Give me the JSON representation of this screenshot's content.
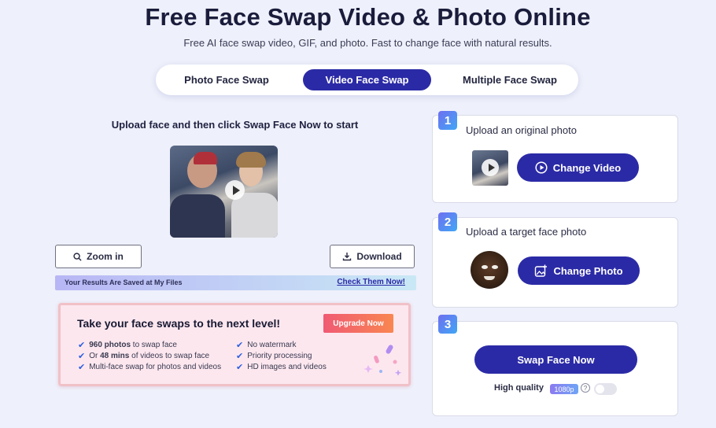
{
  "header": {
    "title": "Free Face Swap Video & Photo Online",
    "subtitle": "Free AI face swap video, GIF, and photo. Fast to change face with natural results."
  },
  "tabs": [
    {
      "label": "Photo Face Swap",
      "active": false
    },
    {
      "label": "Video Face Swap",
      "active": true
    },
    {
      "label": "Multiple Face Swap",
      "active": false
    }
  ],
  "left": {
    "heading": "Upload face and then click Swap Face Now to start",
    "zoom_label": "Zoom in",
    "download_label": "Download",
    "banner": {
      "text": "Your Results Are Saved at My Files",
      "link": "Check Them Now!"
    }
  },
  "promo": {
    "heading": "Take your face swaps to the next level!",
    "upgrade_label": "Upgrade Now",
    "features_left": [
      {
        "bold": "960 photos",
        "rest": " to swap face",
        "prefix": ""
      },
      {
        "bold": "48 mins",
        "rest": " of videos to swap face",
        "prefix": "Or "
      },
      {
        "bold": "",
        "rest": "Multi-face swap for photos and videos",
        "prefix": ""
      }
    ],
    "features_right": [
      "No watermark",
      "Priority processing",
      "HD images and videos"
    ]
  },
  "steps": [
    {
      "num": "1",
      "label": "Upload an original photo",
      "button": "Change Video"
    },
    {
      "num": "2",
      "label": "Upload a target face photo",
      "button": "Change Photo"
    },
    {
      "num": "3",
      "button": "Swap Face Now"
    }
  ],
  "quality": {
    "label": "High quality",
    "badge": "1080p",
    "help": "?",
    "enabled": false
  },
  "colors": {
    "primary": "#2b2aa6",
    "accent": "#f05a73",
    "background": "#eef0fb"
  },
  "icons": [
    "play-icon",
    "search-icon",
    "download-icon",
    "check-icon",
    "play-circle-icon",
    "image-plus-icon",
    "help-icon"
  ]
}
